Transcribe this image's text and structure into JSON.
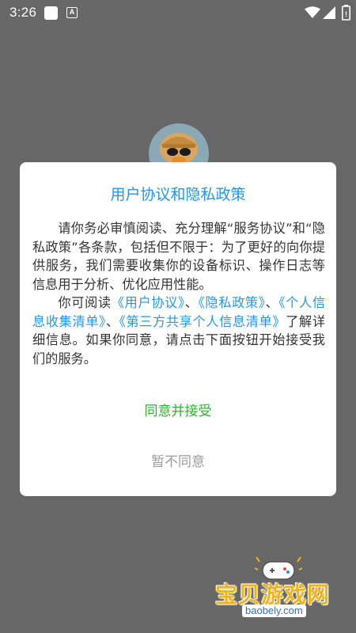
{
  "status_bar": {
    "time": "3:26",
    "notification_icon": "square-notification-icon",
    "a_icon_label": "A",
    "icons": [
      "wifi-icon",
      "signal-icon",
      "battery-icon"
    ]
  },
  "dialog": {
    "title": "用户协议和隐私政策",
    "paragraph1": "请你务必审慎阅读、充分理解“服务协议”和“隐私政策”各条款，包括但不限于：为了更好的向你提供服务，我们需要收集你的设备标识、操作日志等信息用于分析、优化应用性能。",
    "p2_prefix": "你可阅读",
    "link_user_agreement": "《用户协议》",
    "sep1": "、",
    "link_privacy_policy": "《隐私政策》",
    "sep2": "、",
    "link_personal_info_list": "《个人信息收集清单》",
    "sep3": "、",
    "link_third_party_list": "《第三方共享个人信息清单》",
    "p2_suffix": "了解详细信息。如果你同意，请点击下面按钮开始接受我们的服务。",
    "agree_label": "同意并接受",
    "decline_label": "暂不同意"
  },
  "watermark": {
    "logo_text": "宝贝游戏网",
    "url": "baobely.com"
  },
  "colors": {
    "background_dim": "#676767",
    "title_blue": "#2196F3",
    "agree_green": "#27b42e",
    "decline_gray": "#9b9b9b"
  }
}
